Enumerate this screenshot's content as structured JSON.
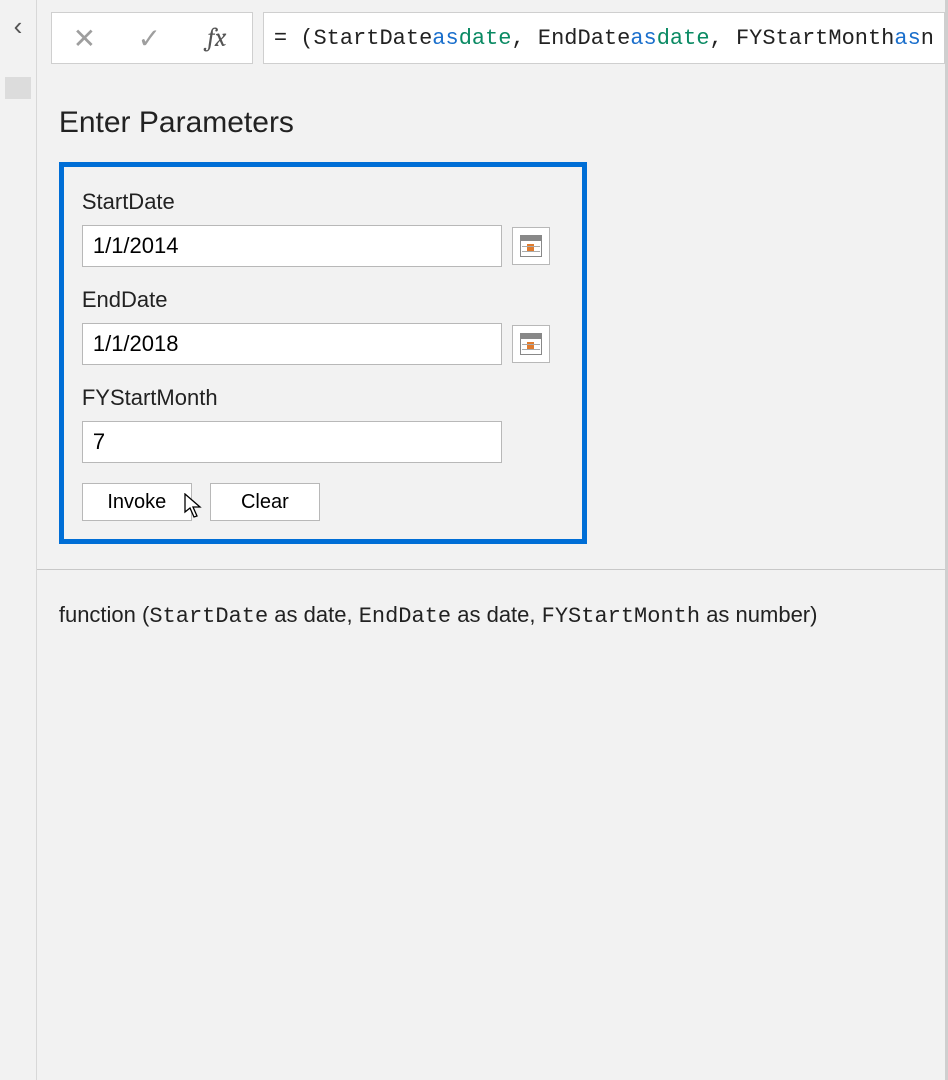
{
  "formula_bar": {
    "cancel_icon": "✕",
    "confirm_icon": "✓",
    "fx_label": "fx",
    "tokens": [
      {
        "t": "= (",
        "c": ""
      },
      {
        "t": "StartDate ",
        "c": ""
      },
      {
        "t": "as",
        "c": "tok-kw"
      },
      {
        "t": " ",
        "c": ""
      },
      {
        "t": "date",
        "c": "tok-type"
      },
      {
        "t": ", EndDate ",
        "c": ""
      },
      {
        "t": "as",
        "c": "tok-kw"
      },
      {
        "t": " ",
        "c": ""
      },
      {
        "t": "date",
        "c": "tok-type"
      },
      {
        "t": ", FYStartMonth ",
        "c": ""
      },
      {
        "t": "as",
        "c": "tok-kw"
      },
      {
        "t": " n",
        "c": ""
      }
    ]
  },
  "section_title": "Enter Parameters",
  "params": {
    "start_label": "StartDate",
    "start_value": "1/1/2014",
    "end_label": "EndDate",
    "end_value": "1/1/2018",
    "month_label": "FYStartMonth",
    "month_value": "7"
  },
  "buttons": {
    "invoke": "Invoke",
    "clear": "Clear"
  },
  "signature": {
    "fn": "function",
    "p1": "StartDate",
    "p1t": " as date, ",
    "p2": "EndDate",
    "p2t": " as date, ",
    "p3": "FYStartMonth",
    "p3t": " as number) "
  }
}
